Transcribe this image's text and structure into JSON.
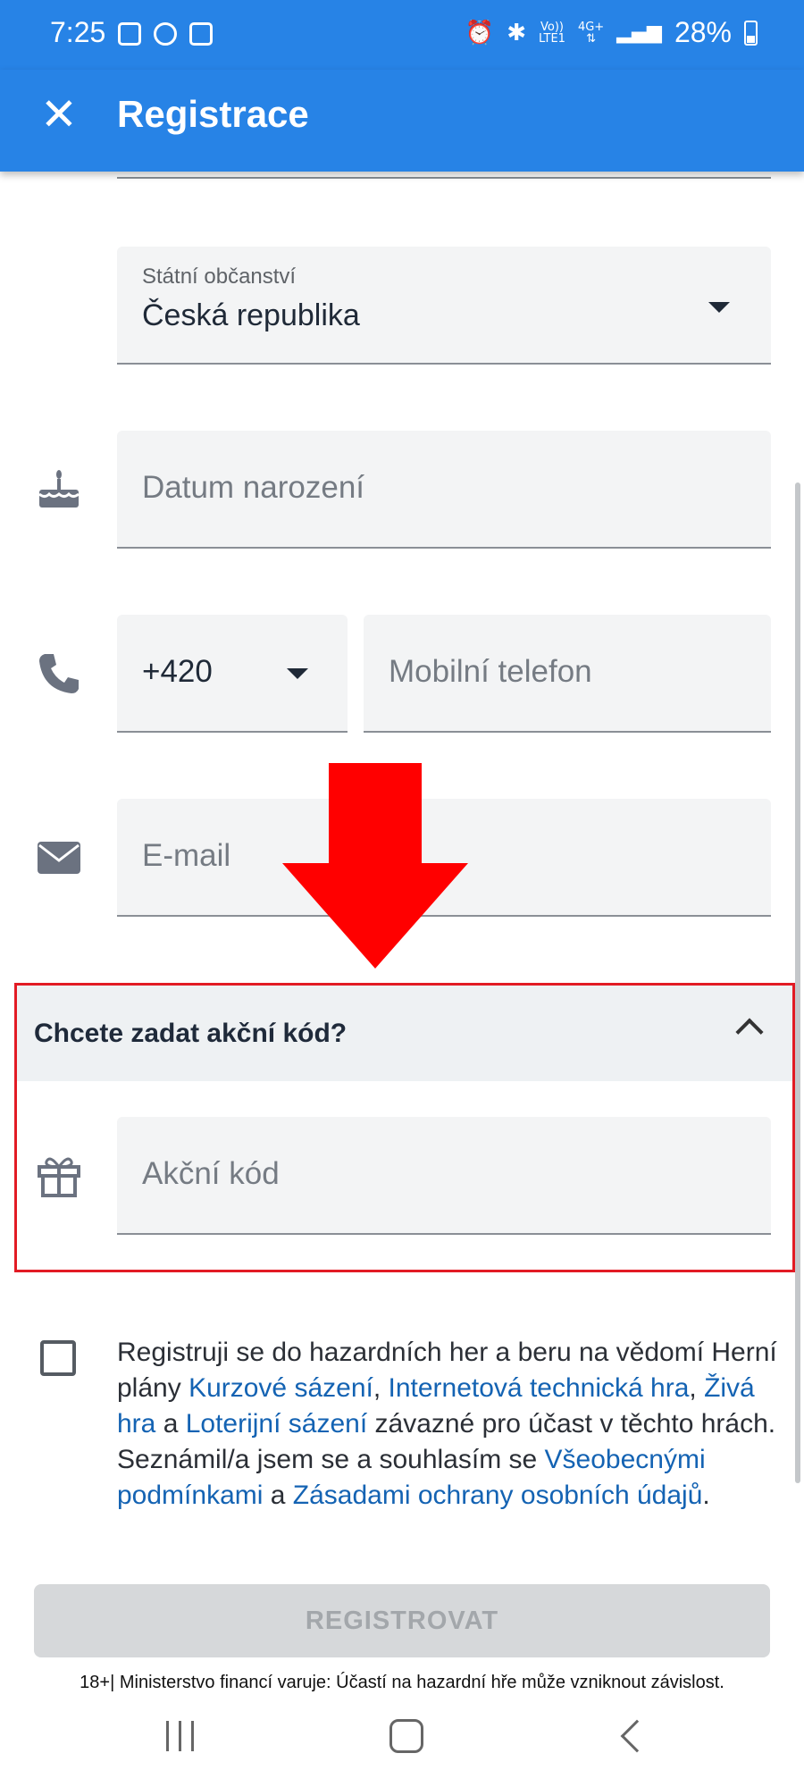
{
  "status_bar": {
    "time": "7:25",
    "network_top": "Vo))",
    "network_bottom": "LTE1",
    "network_4g": "4G+",
    "battery": "28%"
  },
  "app_bar": {
    "title": "Registrace",
    "close_icon": "close-icon"
  },
  "form": {
    "citizenship": {
      "label": "Státní občanství",
      "value": "Česká republika"
    },
    "birth_date": {
      "placeholder": "Datum narození",
      "icon": "cake-icon"
    },
    "phone": {
      "prefix": "+420",
      "placeholder": "Mobilní telefon",
      "icon": "phone-icon"
    },
    "email": {
      "placeholder": "E-mail",
      "icon": "mail-icon"
    }
  },
  "promo": {
    "heading": "Chcete zadat akční kód?",
    "placeholder": "Akční kód",
    "icon": "gift-icon"
  },
  "consent": {
    "t1": "Registruji se do hazardních her a beru na vědomí Herní plány ",
    "l1": "Kurzové sázení",
    "t2": ", ",
    "l2": "Internetová technická hra",
    "t3": ", ",
    "l3": "Živá hra",
    "t4": " a ",
    "l4": "Loterijní sázení",
    "t5": " závazné pro účast v těchto hrách. Seznámil/a jsem se a souhlasím se ",
    "l5": "Všeobecnými podmínkami",
    "t6": " a ",
    "l6": "Zásadami ochrany osobních údajů",
    "t7": "."
  },
  "register_button": "REGISTROVAT",
  "warning": "18+| Ministerstvo financí varuje: Účastí na hazardní hře může vzniknout závislost.",
  "colors": {
    "primary": "#2783e6",
    "highlight_border": "#e21b24",
    "arrow": "#ff0000",
    "link": "#1463b3"
  }
}
